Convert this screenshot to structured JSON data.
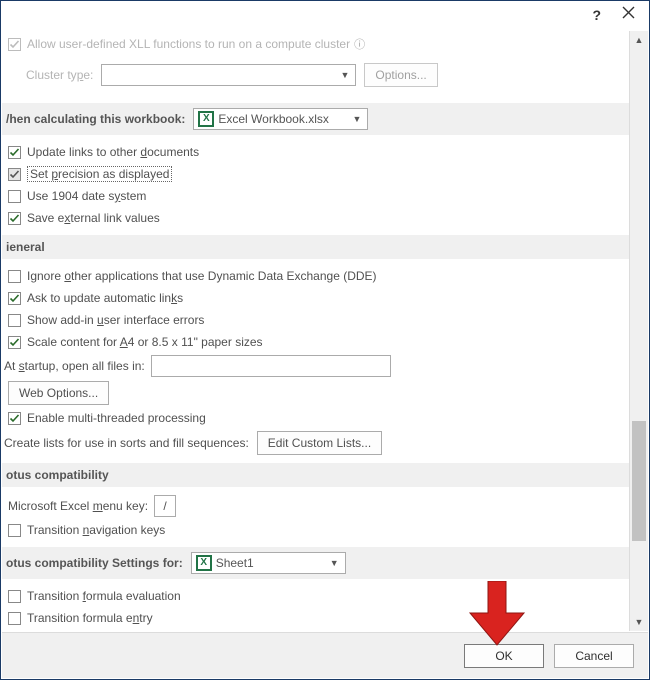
{
  "titlebar": {
    "help": "?",
    "close": "×"
  },
  "xll_row": {
    "label_html": "Allow user-defined XLL functions to run on a compute cluster"
  },
  "cluster": {
    "label_html": "Cluster ty<span class='ul'>p</span>e:",
    "options_btn": "Options..."
  },
  "section_calc": {
    "header_html": "/hen calculating this <span class='ul'>w</span>orkbook:",
    "workbook": "Excel Workbook.xlsx",
    "update_links": "Update links to other <span class='ul'>d</span>ocuments",
    "set_precision": "Set <span class='ul'>p</span>recision as displayed",
    "use_1904": "Use 1904 date s<span class='ul'>y</span>stem",
    "save_external": "Save e<span class='ul'>x</span>ternal link values"
  },
  "section_general": {
    "header": "ieneral",
    "ignore_dde": "Ignore <span class='ul'>o</span>ther applications that use Dynamic Data Exchange (DDE)",
    "ask_update": "Ask to update automatic lin<span class='ul'>k</span>s",
    "show_addin": "Show add-in <span class='ul'>u</span>ser interface errors",
    "scale_content": "Scale content for <span class='ul'>A</span>4 or 8.5 x 11\" paper sizes",
    "startup_label": "At <span class='ul'>s</span>tartup, open all files in:",
    "web_options": "Web <span class='ul'>O</span>ptions...",
    "enable_mt": "Enable multi-threaded processing",
    "create_lists": "Create lists for use in sorts and fill sequences:",
    "edit_custom": "Edit C<span class='ul'>u</span>stom Lists..."
  },
  "section_lotus1": {
    "header": "otus compatibility",
    "menu_key_label": "Microsoft Excel <span class='ul'>m</span>enu key:",
    "menu_key_value": "/",
    "trans_nav": "Transition <span class='ul'>n</span>avigation keys"
  },
  "section_lotus2": {
    "header_html": "otus compatibility Settings <span class='ul'>f</span>or:",
    "sheet": "Sheet1",
    "trans_formula_eval": "Transition <span class='ul'>f</span>ormula evaluation",
    "trans_formula_entry": "Transition formula e<span class='ul'>n</span>try"
  },
  "buttons": {
    "ok": "OK",
    "cancel": "Cancel"
  }
}
